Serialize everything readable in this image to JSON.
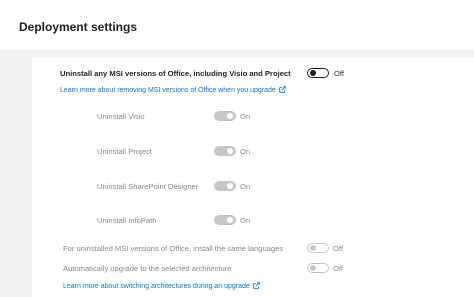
{
  "header": {
    "title": "Deployment settings"
  },
  "msi": {
    "main_label": "Uninstall any MSI versions of Office, including Visio and Project",
    "main_state": "Off",
    "learn_link": "Learn more about removing MSI versions of Office when you upgrade",
    "items": [
      {
        "label": "Uninstall Visio",
        "state": "On"
      },
      {
        "label": "Uninstall Project",
        "state": "On"
      },
      {
        "label": "Uninstall SharePoint Designer",
        "state": "On"
      },
      {
        "label": "Uninstall InfoPath",
        "state": "On"
      }
    ],
    "languages_label": "For uninstalled MSI versions of Office, install the same languages",
    "languages_state": "Off",
    "arch_label": "Automatically upgrade to the selected architecture",
    "arch_state": "Off",
    "arch_link": "Learn more about switching architectures during an upgrade"
  },
  "colors": {
    "link": "#0078d4",
    "text": "#323130",
    "disabled_text": "#8a8886",
    "disabled_toggle": "#c8c6c4"
  },
  "icons": {
    "external_link": "external-link-icon"
  }
}
